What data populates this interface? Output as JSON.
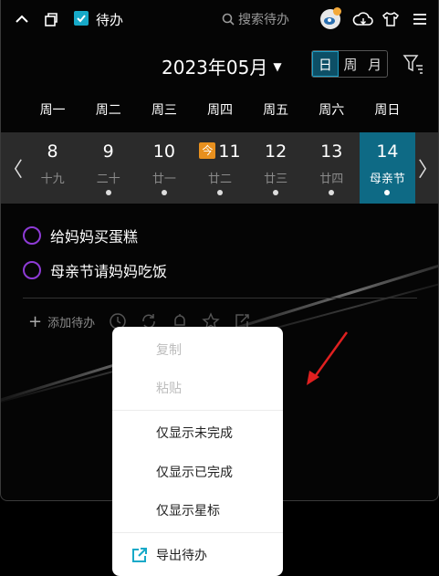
{
  "topbar": {
    "title": "待办",
    "search_placeholder": "搜索待办"
  },
  "calendar": {
    "month_label": "2023年05月",
    "view_modes": [
      "日",
      "周",
      "月"
    ],
    "active_view": "日",
    "weekdays": [
      "周一",
      "周二",
      "周三",
      "周四",
      "周五",
      "周六",
      "周日"
    ],
    "today_badge": "今",
    "days": [
      {
        "num": "8",
        "lunar": "十九",
        "has_dot": false
      },
      {
        "num": "9",
        "lunar": "二十",
        "has_dot": true
      },
      {
        "num": "10",
        "lunar": "廿一",
        "has_dot": true
      },
      {
        "num": "11",
        "lunar": "廿二",
        "has_dot": true,
        "today": true
      },
      {
        "num": "12",
        "lunar": "廿三",
        "has_dot": true
      },
      {
        "num": "13",
        "lunar": "廿四",
        "has_dot": true
      },
      {
        "num": "14",
        "lunar": "母亲节",
        "has_dot": true,
        "selected": true
      }
    ]
  },
  "tasks": [
    {
      "label": "给妈妈买蛋糕"
    },
    {
      "label": "母亲节请妈妈吃饭"
    }
  ],
  "add_todo_label": "添加待办",
  "context_menu": {
    "items": [
      {
        "label": "复制",
        "disabled": true
      },
      {
        "label": "粘贴",
        "disabled": true
      },
      {
        "label": "仅显示未完成",
        "disabled": false
      },
      {
        "label": "仅显示已完成",
        "disabled": false
      },
      {
        "label": "仅显示星标",
        "disabled": false
      },
      {
        "label": "导出待办",
        "disabled": false,
        "icon": "export-icon"
      }
    ]
  },
  "colors": {
    "accent": "#0e6a85",
    "check": "#17a9c8",
    "task_circle": "#8e3bd6",
    "today_badge": "#e8901e",
    "annotation_arrow": "#e02020"
  }
}
